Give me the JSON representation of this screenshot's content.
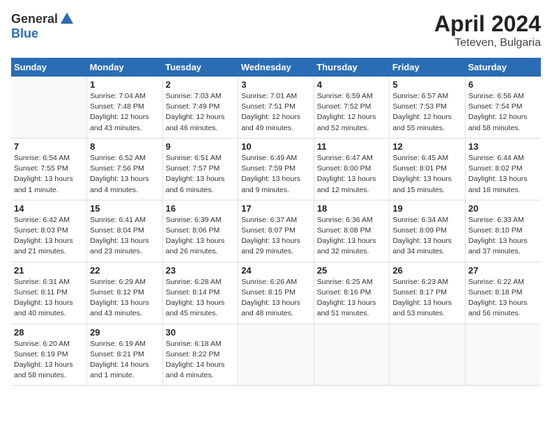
{
  "header": {
    "logo_general": "General",
    "logo_blue": "Blue",
    "title": "April 2024",
    "subtitle": "Teteven, Bulgaria"
  },
  "days_of_week": [
    "Sunday",
    "Monday",
    "Tuesday",
    "Wednesday",
    "Thursday",
    "Friday",
    "Saturday"
  ],
  "weeks": [
    [
      {
        "day": "",
        "info": ""
      },
      {
        "day": "1",
        "info": "Sunrise: 7:04 AM\nSunset: 7:48 PM\nDaylight: 12 hours\nand 43 minutes."
      },
      {
        "day": "2",
        "info": "Sunrise: 7:03 AM\nSunset: 7:49 PM\nDaylight: 12 hours\nand 46 minutes."
      },
      {
        "day": "3",
        "info": "Sunrise: 7:01 AM\nSunset: 7:51 PM\nDaylight: 12 hours\nand 49 minutes."
      },
      {
        "day": "4",
        "info": "Sunrise: 6:59 AM\nSunset: 7:52 PM\nDaylight: 12 hours\nand 52 minutes."
      },
      {
        "day": "5",
        "info": "Sunrise: 6:57 AM\nSunset: 7:53 PM\nDaylight: 12 hours\nand 55 minutes."
      },
      {
        "day": "6",
        "info": "Sunrise: 6:56 AM\nSunset: 7:54 PM\nDaylight: 12 hours\nand 58 minutes."
      }
    ],
    [
      {
        "day": "7",
        "info": "Sunrise: 6:54 AM\nSunset: 7:55 PM\nDaylight: 13 hours\nand 1 minute."
      },
      {
        "day": "8",
        "info": "Sunrise: 6:52 AM\nSunset: 7:56 PM\nDaylight: 13 hours\nand 4 minutes."
      },
      {
        "day": "9",
        "info": "Sunrise: 6:51 AM\nSunset: 7:57 PM\nDaylight: 13 hours\nand 6 minutes."
      },
      {
        "day": "10",
        "info": "Sunrise: 6:49 AM\nSunset: 7:59 PM\nDaylight: 13 hours\nand 9 minutes."
      },
      {
        "day": "11",
        "info": "Sunrise: 6:47 AM\nSunset: 8:00 PM\nDaylight: 13 hours\nand 12 minutes."
      },
      {
        "day": "12",
        "info": "Sunrise: 6:45 AM\nSunset: 8:01 PM\nDaylight: 13 hours\nand 15 minutes."
      },
      {
        "day": "13",
        "info": "Sunrise: 6:44 AM\nSunset: 8:02 PM\nDaylight: 13 hours\nand 18 minutes."
      }
    ],
    [
      {
        "day": "14",
        "info": "Sunrise: 6:42 AM\nSunset: 8:03 PM\nDaylight: 13 hours\nand 21 minutes."
      },
      {
        "day": "15",
        "info": "Sunrise: 6:41 AM\nSunset: 8:04 PM\nDaylight: 13 hours\nand 23 minutes."
      },
      {
        "day": "16",
        "info": "Sunrise: 6:39 AM\nSunset: 8:06 PM\nDaylight: 13 hours\nand 26 minutes."
      },
      {
        "day": "17",
        "info": "Sunrise: 6:37 AM\nSunset: 8:07 PM\nDaylight: 13 hours\nand 29 minutes."
      },
      {
        "day": "18",
        "info": "Sunrise: 6:36 AM\nSunset: 8:08 PM\nDaylight: 13 hours\nand 32 minutes."
      },
      {
        "day": "19",
        "info": "Sunrise: 6:34 AM\nSunset: 8:09 PM\nDaylight: 13 hours\nand 34 minutes."
      },
      {
        "day": "20",
        "info": "Sunrise: 6:33 AM\nSunset: 8:10 PM\nDaylight: 13 hours\nand 37 minutes."
      }
    ],
    [
      {
        "day": "21",
        "info": "Sunrise: 6:31 AM\nSunset: 8:11 PM\nDaylight: 13 hours\nand 40 minutes."
      },
      {
        "day": "22",
        "info": "Sunrise: 6:29 AM\nSunset: 8:12 PM\nDaylight: 13 hours\nand 43 minutes."
      },
      {
        "day": "23",
        "info": "Sunrise: 6:28 AM\nSunset: 8:14 PM\nDaylight: 13 hours\nand 45 minutes."
      },
      {
        "day": "24",
        "info": "Sunrise: 6:26 AM\nSunset: 8:15 PM\nDaylight: 13 hours\nand 48 minutes."
      },
      {
        "day": "25",
        "info": "Sunrise: 6:25 AM\nSunset: 8:16 PM\nDaylight: 13 hours\nand 51 minutes."
      },
      {
        "day": "26",
        "info": "Sunrise: 6:23 AM\nSunset: 8:17 PM\nDaylight: 13 hours\nand 53 minutes."
      },
      {
        "day": "27",
        "info": "Sunrise: 6:22 AM\nSunset: 8:18 PM\nDaylight: 13 hours\nand 56 minutes."
      }
    ],
    [
      {
        "day": "28",
        "info": "Sunrise: 6:20 AM\nSunset: 8:19 PM\nDaylight: 13 hours\nand 58 minutes."
      },
      {
        "day": "29",
        "info": "Sunrise: 6:19 AM\nSunset: 8:21 PM\nDaylight: 14 hours\nand 1 minute."
      },
      {
        "day": "30",
        "info": "Sunrise: 6:18 AM\nSunset: 8:22 PM\nDaylight: 14 hours\nand 4 minutes."
      },
      {
        "day": "",
        "info": ""
      },
      {
        "day": "",
        "info": ""
      },
      {
        "day": "",
        "info": ""
      },
      {
        "day": "",
        "info": ""
      }
    ]
  ]
}
